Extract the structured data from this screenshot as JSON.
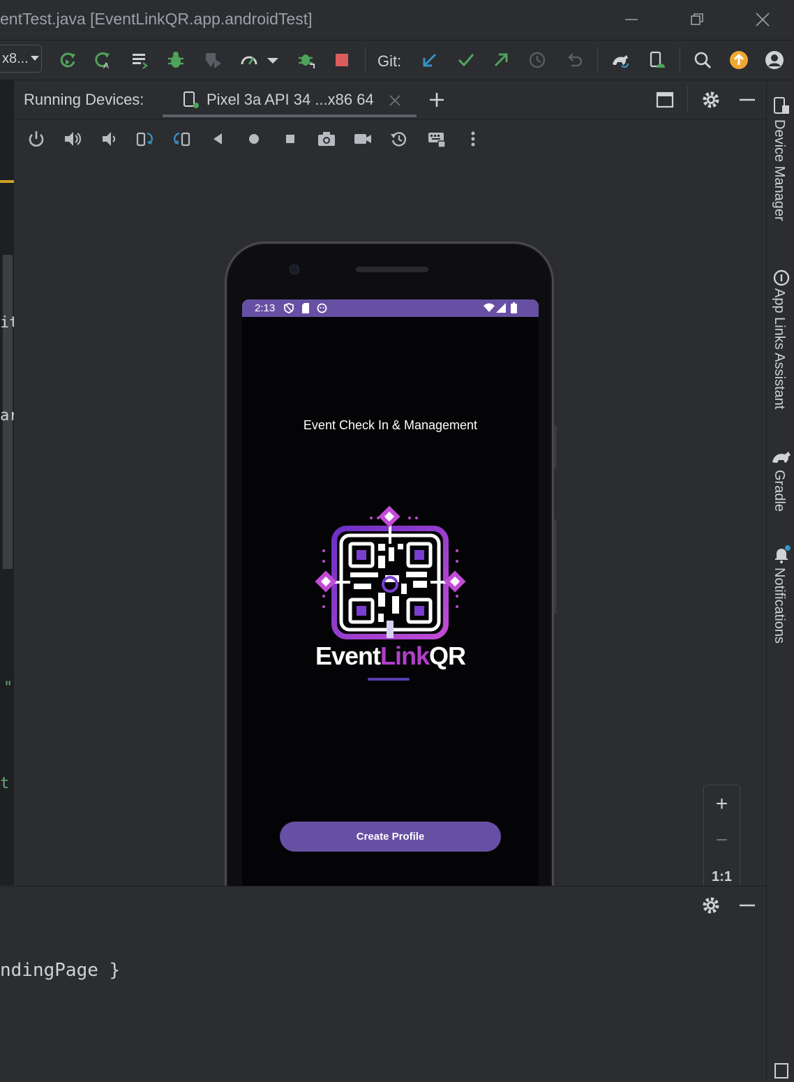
{
  "window": {
    "title": "entTest.java [EventLinkQR.app.androidTest]"
  },
  "toolbar": {
    "config_combo": "x8...",
    "git_label": "Git:",
    "update_badge_color": "#f0a732"
  },
  "editor_fragments": [
    "it",
    "ar",
    "\"",
    "t"
  ],
  "running_devices": {
    "label": "Running Devices:",
    "device_tab": "Pixel 3a API 34 ...x86 64"
  },
  "phone": {
    "status_time": "2:13",
    "tagline": "Event Check In & Management",
    "logo": {
      "text_part1": "Event",
      "text_part2": "Link",
      "text_part3": "QR"
    },
    "create_button": "Create Profile",
    "accent_color": "#6750a4"
  },
  "zoom": {
    "zoom_in": "+",
    "zoom_out": "−",
    "actual_size": "1:1"
  },
  "right_tools": [
    "Device Manager",
    "App Links Assistant",
    "Gradle",
    "Notifications"
  ],
  "bottom_panel": {
    "code": "ndingPage }"
  }
}
